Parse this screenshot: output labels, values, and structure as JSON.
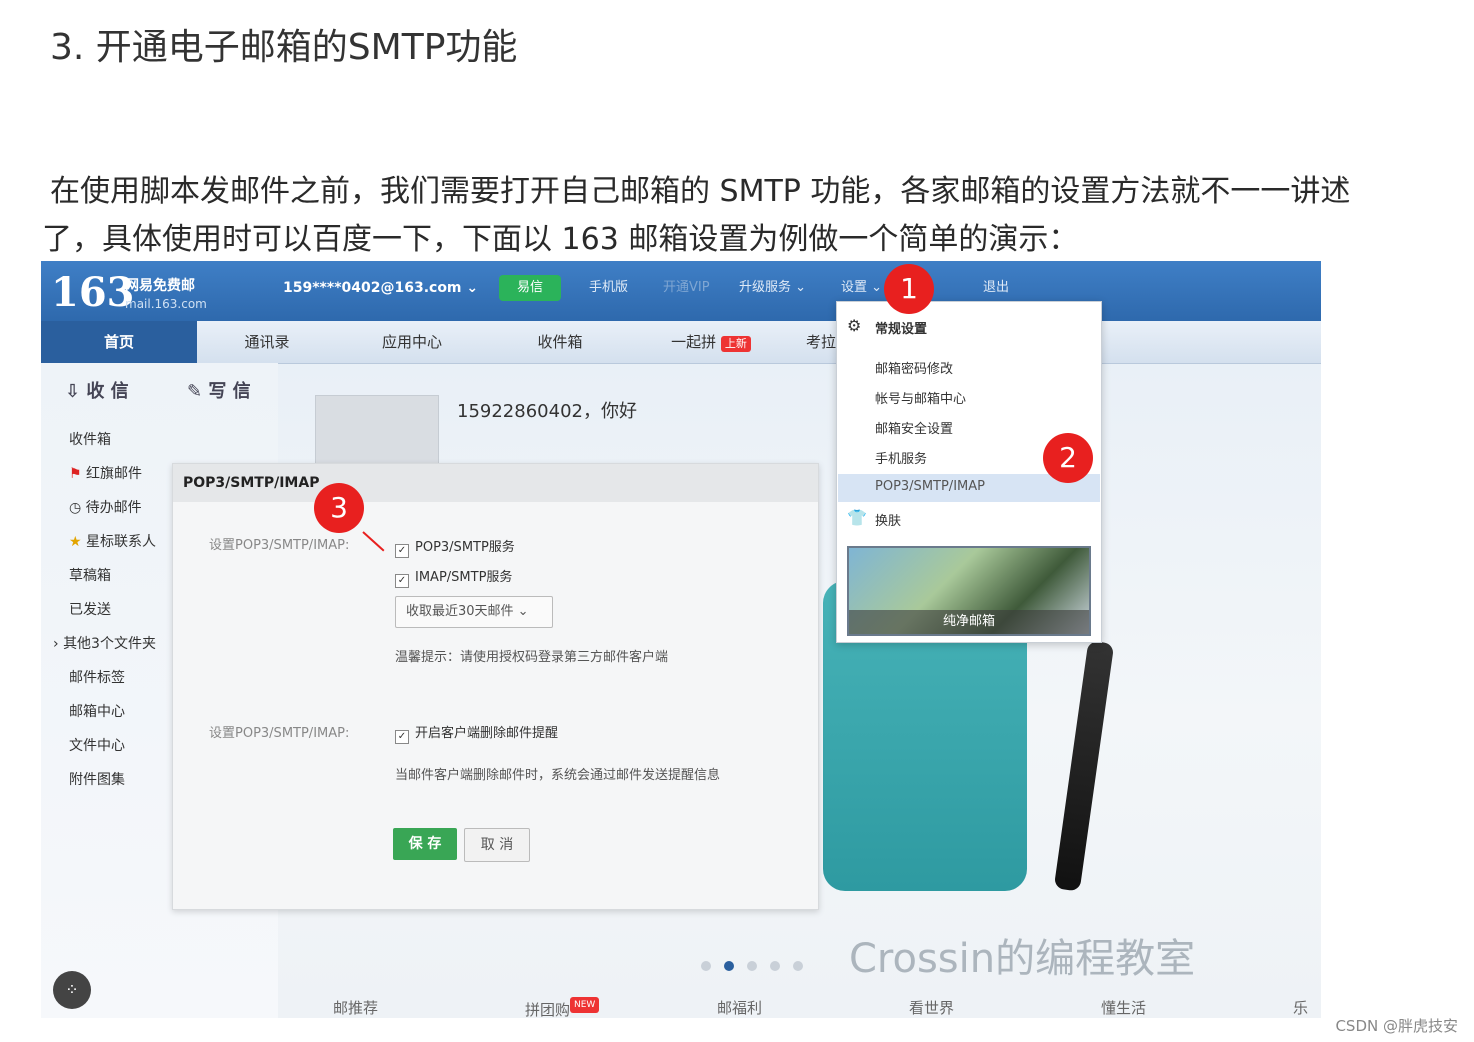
{
  "heading": "3. 开通电子邮箱的SMTP功能",
  "paragraph": {
    "line1": "在使用脚本发邮件之前，我们需要打开自己邮箱的 SMTP 功能，各家邮箱的设置方法就不一一讲述",
    "line2": "了，具体使用时可以百度一下，下面以 163 邮箱设置为例做一个简单的演示："
  },
  "screenshot": {
    "logo": {
      "number": "163",
      "name": "网易免费邮",
      "domain": "mail.163.com"
    },
    "account": "159****0402@163.com ⌄",
    "topbar": {
      "yixin": "易信",
      "mobile": "手机版",
      "vip": "开通VIP",
      "upgrade": "升级服务 ⌄",
      "settings": "设置 ⌄",
      "exit": "退出"
    },
    "nav": {
      "home": "首页",
      "contacts": "通讯录",
      "apps": "应用中心",
      "inbox": "收件箱",
      "pin": "一起拼",
      "pin_badge": "上新",
      "more": "考拉"
    },
    "sidebar": {
      "receive": "收 信",
      "write": "写 信",
      "folders": [
        "收件箱",
        "红旗邮件",
        "待办邮件",
        "星标联系人",
        "草稿箱",
        "已发送",
        "其他3个文件夹",
        "邮件标签",
        "邮箱中心",
        "文件中心",
        "附件图集"
      ]
    },
    "greeting": "15922860402，你好",
    "dialog": {
      "title": "POP3/SMTP/IMAP",
      "label1": "设置POP3/SMTP/IMAP:",
      "opt1": "POP3/SMTP服务",
      "opt2": "IMAP/SMTP服务",
      "select": "收取最近30天邮件 ⌄",
      "tip1": "温馨提示：请使用授权码登录第三方邮件客户端",
      "label2": "设置POP3/SMTP/IMAP:",
      "opt3": "开启客户端删除邮件提醒",
      "tip2": "当邮件客户端删除邮件时，系统会通过邮件发送提醒信息",
      "save": "保 存",
      "cancel": "取 消"
    },
    "dropdown": {
      "general": "常规设置",
      "items": [
        "邮箱密码修改",
        "帐号与邮箱中心",
        "邮箱安全设置",
        "手机服务",
        "POP3/SMTP/IMAP"
      ],
      "skin": "换肤",
      "banner": "纯净邮箱"
    },
    "markers": [
      "1",
      "2",
      "3"
    ],
    "footer": [
      "邮推荐",
      "拼团购",
      "邮福利",
      "看世界",
      "懂生活",
      "乐"
    ],
    "footer_badge": "NEW",
    "watermark": "Crossin的编程教室"
  },
  "csdn": "CSDN @胖虎技安",
  "colors": {
    "marker": "#e8201f",
    "topbar": "#3f7fc6",
    "save": "#39a655"
  }
}
